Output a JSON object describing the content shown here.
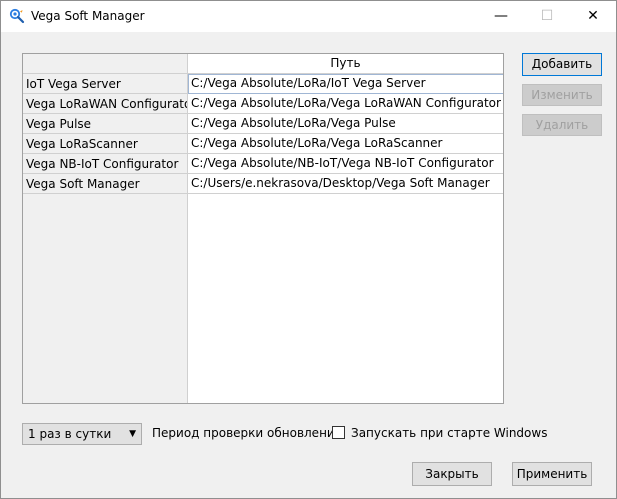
{
  "window": {
    "title": "Vega Soft Manager",
    "minimize_glyph": "—",
    "maximize_glyph": "☐",
    "close_glyph": "✕"
  },
  "table": {
    "column_header": "Путь",
    "rows": [
      {
        "name": "IoT Vega Server",
        "path": "C:/Vega Absolute/LoRa/IoT Vega Server"
      },
      {
        "name": "Vega LoRaWAN Configurator",
        "path": "C:/Vega Absolute/LoRa/Vega LoRaWAN Configurator"
      },
      {
        "name": "Vega Pulse",
        "path": "C:/Vega Absolute/LoRa/Vega Pulse"
      },
      {
        "name": "Vega LoRaScanner",
        "path": "C:/Vega Absolute/LoRa/Vega LoRaScanner"
      },
      {
        "name": "Vega NB-IoT Configurator",
        "path": "C:/Vega Absolute/NB-IoT/Vega NB-IoT Configurator"
      },
      {
        "name": "Vega Soft Manager",
        "path": "C:/Users/e.nekrasova/Desktop/Vega Soft Manager"
      }
    ]
  },
  "buttons": {
    "add": "Добавить",
    "edit": "Изменить",
    "delete": "Удалить",
    "close": "Закрыть",
    "apply": "Применить"
  },
  "update_period": {
    "selected": "1 раз в сутки",
    "label": "Период проверки обновлений"
  },
  "autostart": {
    "label": "Запускать при старте Windows",
    "checked": false
  },
  "colors": {
    "accent": "#0078d7",
    "selection_outline": "#a0b6d4"
  }
}
